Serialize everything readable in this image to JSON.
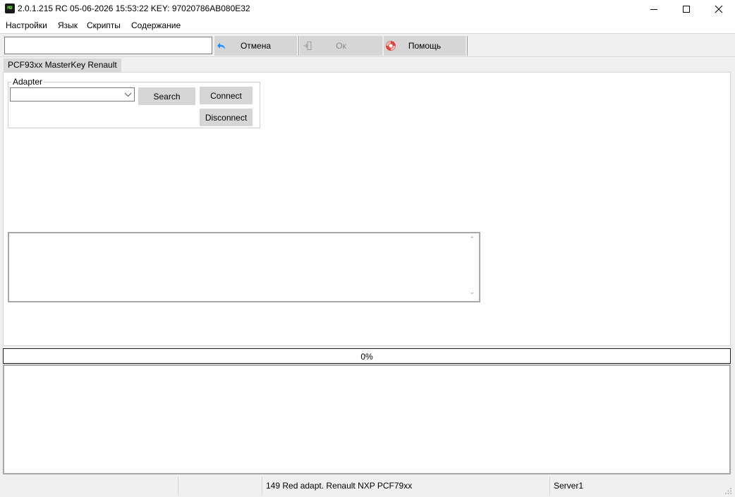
{
  "window": {
    "icon_text": "MD",
    "title": "2.0.1.215 RC 05-06-2026 15:53:22  KEY: 97020786AB080E32"
  },
  "menu": {
    "items": [
      "Настройки",
      "Язык",
      "Скрипты",
      "Содержание"
    ]
  },
  "toolbar": {
    "input_value": "",
    "cancel_label": "Отмена",
    "ok_label": "Ок",
    "help_label": "Помощь",
    "accent_color": "#1e90ff",
    "help_color": "#e0443a"
  },
  "tabs": [
    {
      "label": "PCF93xx MasterKey Renault",
      "active": true
    }
  ],
  "adapter": {
    "group_label": "Adapter",
    "selected_value": "",
    "search_label": "Search",
    "connect_label": "Connect",
    "disconnect_label": "Disconnect"
  },
  "memo": {
    "content": ""
  },
  "progress": {
    "value": 0,
    "text": "0%"
  },
  "log": {
    "content": ""
  },
  "status": {
    "panels": [
      "",
      "",
      "149 Red adapt. Renault NXP PCF79xx",
      "Server1"
    ]
  }
}
